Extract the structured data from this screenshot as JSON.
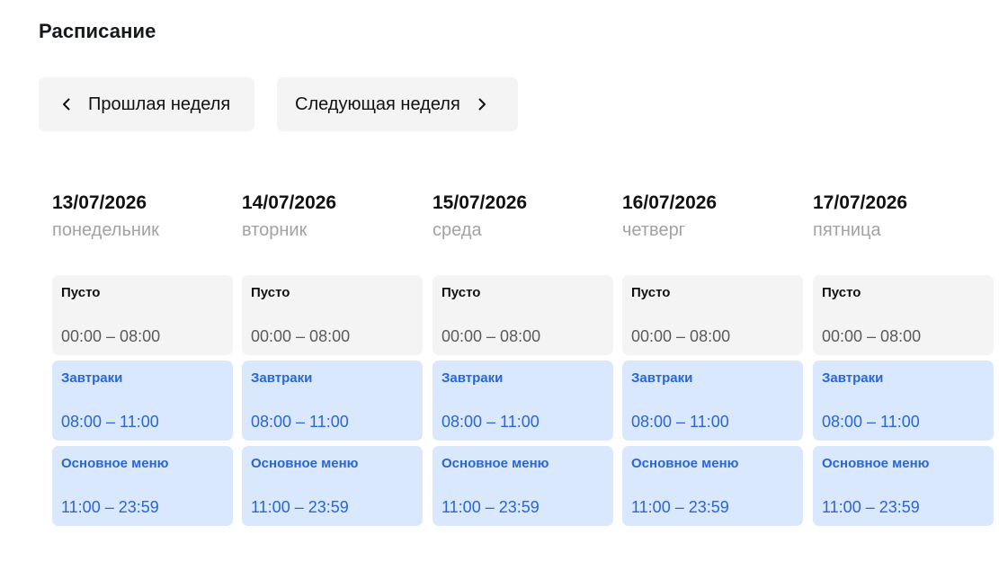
{
  "page": {
    "title": "Расписание"
  },
  "nav": {
    "prev_label": "Прошлая неделя",
    "next_label": "Следующая неделя",
    "prev_icon": "chevron-left-icon",
    "next_icon": "chevron-right-icon"
  },
  "colors": {
    "empty_bg": "#f4f4f4",
    "menu_bg": "#d9e8fc",
    "menu_text": "#2a66d4",
    "muted_text": "#a2a2a2"
  },
  "days": [
    {
      "date": "13/07/2026",
      "weekday": "понедельник",
      "slots": [
        {
          "title": "Пусто",
          "time": "00:00 – 08:00",
          "kind": "empty"
        },
        {
          "title": "Завтраки",
          "time": "08:00 – 11:00",
          "kind": "menu"
        },
        {
          "title": "Основное меню",
          "time": "11:00 – 23:59",
          "kind": "menu"
        }
      ]
    },
    {
      "date": "14/07/2026",
      "weekday": "вторник",
      "slots": [
        {
          "title": "Пусто",
          "time": "00:00 – 08:00",
          "kind": "empty"
        },
        {
          "title": "Завтраки",
          "time": "08:00 – 11:00",
          "kind": "menu"
        },
        {
          "title": "Основное меню",
          "time": "11:00 – 23:59",
          "kind": "menu"
        }
      ]
    },
    {
      "date": "15/07/2026",
      "weekday": "среда",
      "slots": [
        {
          "title": "Пусто",
          "time": "00:00 – 08:00",
          "kind": "empty"
        },
        {
          "title": "Завтраки",
          "time": "08:00 – 11:00",
          "kind": "menu"
        },
        {
          "title": "Основное меню",
          "time": "11:00 – 23:59",
          "kind": "menu"
        }
      ]
    },
    {
      "date": "16/07/2026",
      "weekday": "четверг",
      "slots": [
        {
          "title": "Пусто",
          "time": "00:00 – 08:00",
          "kind": "empty"
        },
        {
          "title": "Завтраки",
          "time": "08:00 – 11:00",
          "kind": "menu"
        },
        {
          "title": "Основное меню",
          "time": "11:00 – 23:59",
          "kind": "menu"
        }
      ]
    },
    {
      "date": "17/07/2026",
      "weekday": "пятница",
      "slots": [
        {
          "title": "Пусто",
          "time": "00:00 – 08:00",
          "kind": "empty"
        },
        {
          "title": "Завтраки",
          "time": "08:00 – 11:00",
          "kind": "menu"
        },
        {
          "title": "Основное меню",
          "time": "11:00 – 23:59",
          "kind": "menu"
        }
      ]
    }
  ]
}
